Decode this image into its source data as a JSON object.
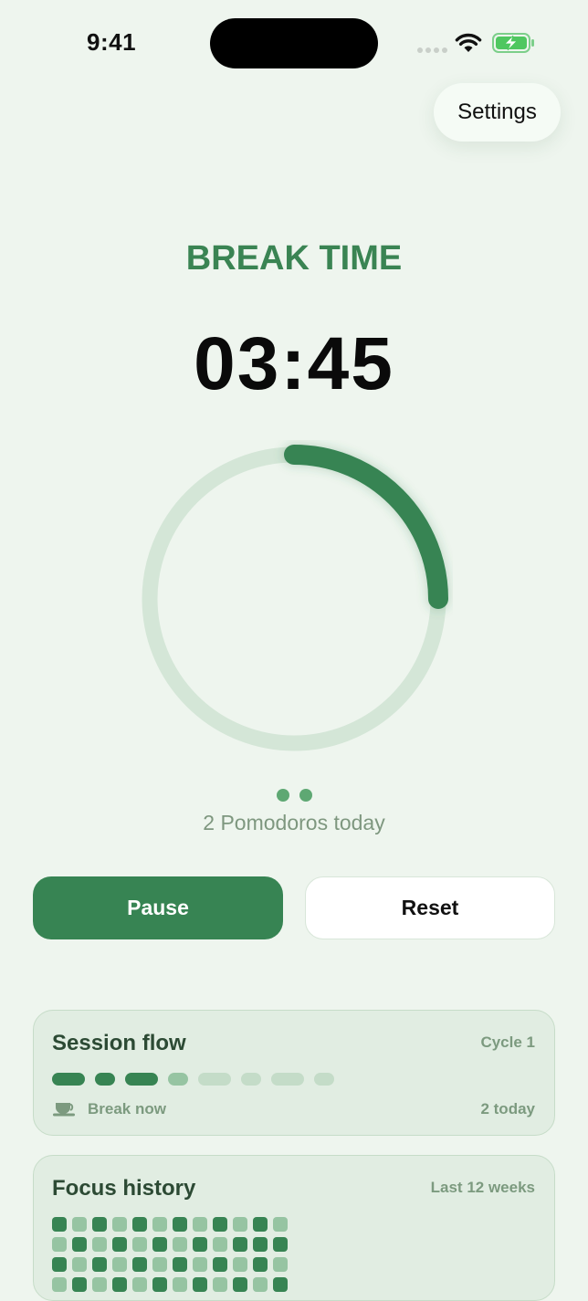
{
  "status_bar": {
    "time": "9:41",
    "battery_charging": true
  },
  "header": {
    "settings_label": "Settings"
  },
  "timer": {
    "mode_label": "BREAK TIME",
    "remaining": "03:45",
    "progress_fraction": 0.25,
    "colors": {
      "accent": "#378453",
      "track": "#d4e6d7"
    }
  },
  "pomodoros": {
    "completed_dots": 2,
    "summary": "2 Pomodoros today"
  },
  "controls": {
    "primary_label": "Pause",
    "secondary_label": "Reset"
  },
  "session_flow": {
    "title": "Session flow",
    "cycle_label": "Cycle 1",
    "segments": [
      {
        "kind": "focus",
        "state": "done"
      },
      {
        "kind": "short-break",
        "state": "done"
      },
      {
        "kind": "focus",
        "state": "done"
      },
      {
        "kind": "short-break",
        "state": "current"
      },
      {
        "kind": "focus",
        "state": "upcoming"
      },
      {
        "kind": "short-break",
        "state": "upcoming"
      },
      {
        "kind": "focus",
        "state": "upcoming"
      },
      {
        "kind": "short-break",
        "state": "upcoming"
      }
    ],
    "footer_icon": "coffee-cup-icon",
    "footer_label": "Break now",
    "footer_count": "2 today"
  },
  "focus_history": {
    "title": "Focus history",
    "range_label": "Last 12 weeks",
    "levels": [
      [
        3,
        1,
        3,
        1,
        3,
        1,
        3,
        1,
        3,
        1,
        3,
        1
      ],
      [
        1,
        3,
        1,
        3,
        1,
        3,
        1,
        3,
        1,
        3,
        3,
        3
      ],
      [
        3,
        1,
        3,
        1,
        3,
        1,
        3,
        1,
        3,
        1,
        3,
        1
      ],
      [
        1,
        3,
        1,
        3,
        1,
        3,
        1,
        3,
        1,
        3,
        1,
        3
      ]
    ],
    "level_colors": [
      "#e1ede2",
      "#96c4a2",
      "#6aa87d",
      "#378453"
    ]
  }
}
